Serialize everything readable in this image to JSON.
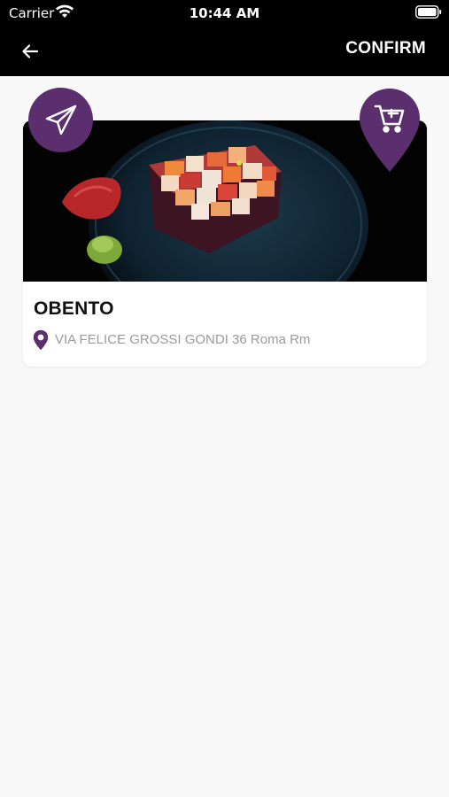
{
  "status_bar": {
    "carrier": "Carrier",
    "time": "10:44 AM"
  },
  "nav": {
    "confirm_label": "CONFIRM"
  },
  "restaurant": {
    "name": "OBENTO",
    "address": "VIA FELICE GROSSI GONDI 36 Roma Rm"
  },
  "colors": {
    "accent": "#5b2f6e",
    "nav_background": "#000000",
    "page_background": "#f8f8f8",
    "address_text": "#9a9a9a"
  },
  "icons": {
    "back": "arrow-left-icon",
    "send": "paper-plane-icon",
    "cart": "shopping-cart-icon",
    "pin": "location-pin-icon"
  }
}
